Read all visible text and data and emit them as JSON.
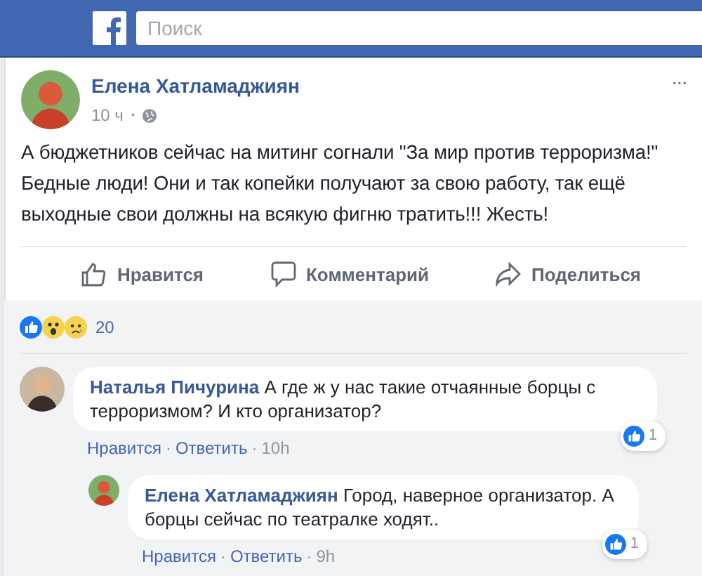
{
  "top_bar": {
    "search": {
      "placeholder": "Поиск"
    }
  },
  "post": {
    "author": "Елена Хатламаджиян",
    "time": "10 ч",
    "separator": "·",
    "more": "···",
    "text": "А бюджетников сейчас на митинг согнали \"За мир против терроризма!\" Бедные люди! Они и так копейки получают за свою работу, так ещё выходные свои должны на всякую фигню тратить!!! Жесть!",
    "actions": [
      {
        "kind": "like",
        "label": "Нравится"
      },
      {
        "kind": "comment",
        "label": "Комментарий"
      },
      {
        "kind": "share",
        "label": "Поделиться"
      }
    ],
    "reactions": {
      "types": [
        {
          "kind": "like"
        },
        {
          "kind": "wow"
        },
        {
          "kind": "sad"
        }
      ],
      "count": "20"
    }
  },
  "comments": [
    {
      "author": "Наталья Пичурина",
      "text": "А где ж у нас такие отчаянные борцы с терроризмом? И кто организатор?",
      "like": "Нравится",
      "separators": [
        "·",
        "·"
      ],
      "reply": "Ответить",
      "time": "10h",
      "likes": "1",
      "children": [
        {
          "author": "Елена Хатламаджиян",
          "text": "Город, наверное организатор. А борцы сейчас по театралке ходят..",
          "like": "Нравится",
          "separators": [
            "·",
            "·"
          ],
          "reply": "Ответить",
          "time": "9h",
          "likes": "1"
        }
      ]
    }
  ]
}
